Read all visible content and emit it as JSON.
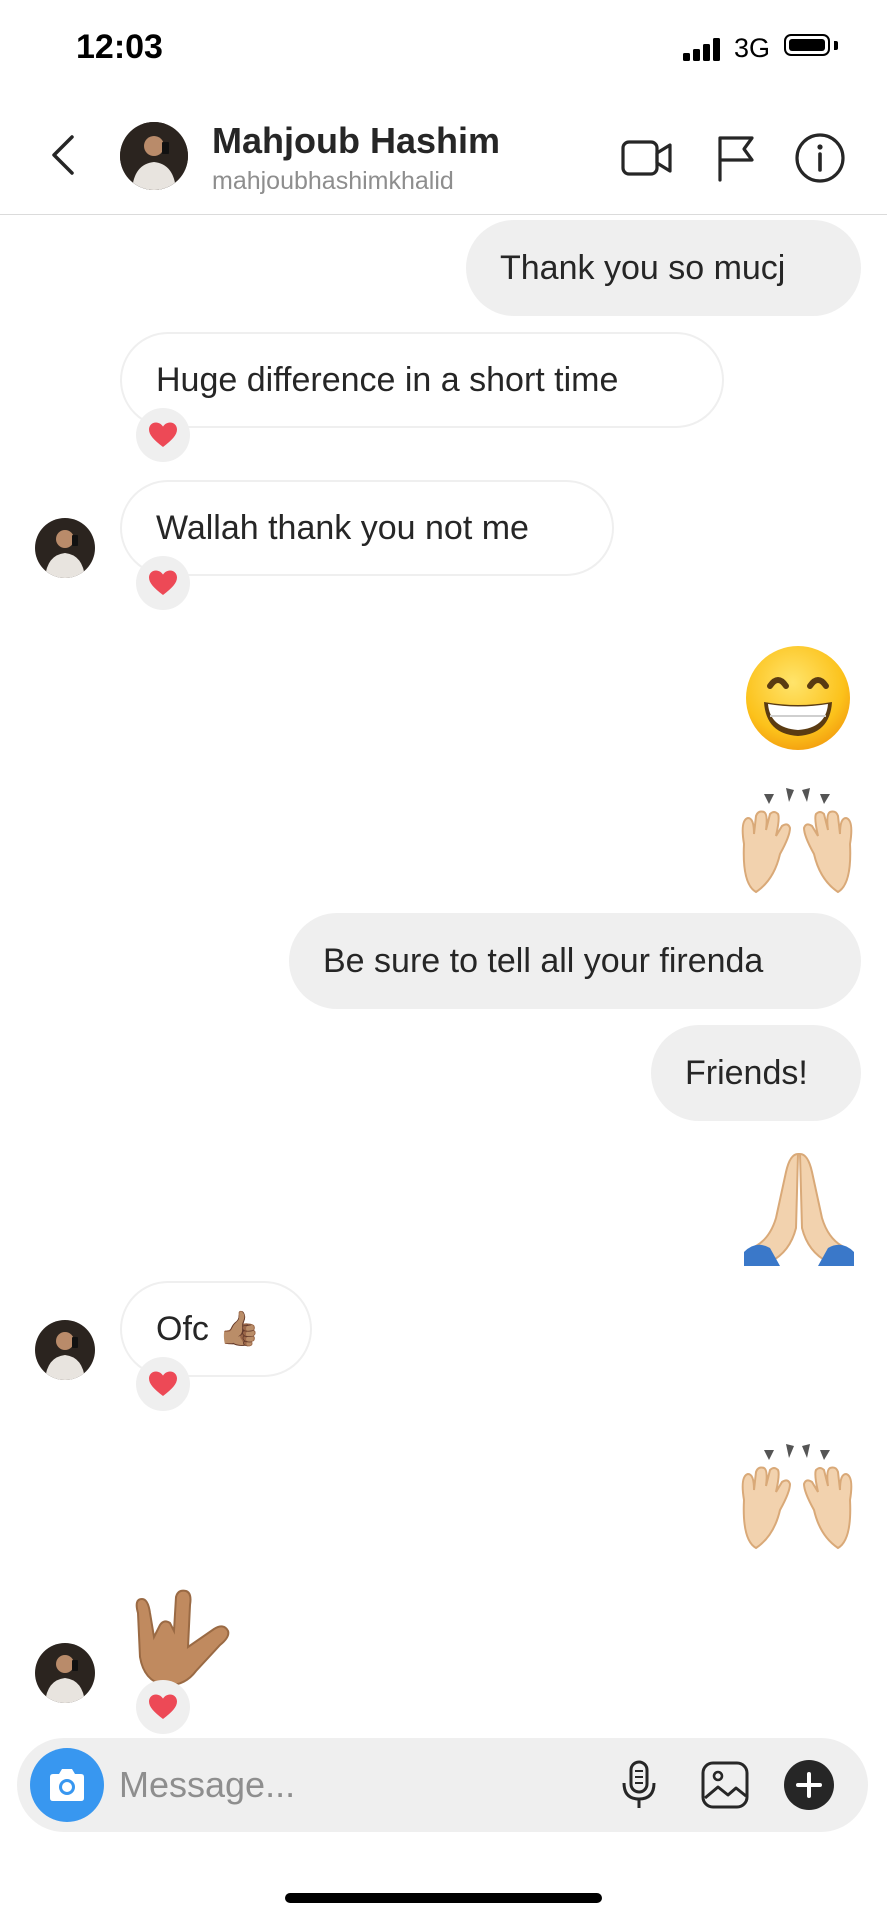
{
  "status_bar": {
    "time": "12:03",
    "network": "3G"
  },
  "header": {
    "name": "Mahjoub Hashim",
    "handle": "mahjoubhashimkhalid",
    "icons": [
      "back-chevron-icon",
      "video-call-icon",
      "flag-icon",
      "info-icon"
    ]
  },
  "messages": [
    {
      "side": "out",
      "text": "Thank you so mucj"
    },
    {
      "side": "in",
      "text": "Huge difference in a short time",
      "reaction": "heart"
    },
    {
      "side": "in",
      "text": "Wallah thank you not me",
      "reaction": "heart"
    },
    {
      "side": "out",
      "emoji": "😁"
    },
    {
      "side": "out",
      "emoji": "🙌"
    },
    {
      "side": "out",
      "text": "Be sure to tell all your firenda"
    },
    {
      "side": "out",
      "text": "Friends!"
    },
    {
      "side": "out",
      "emoji": "🙏"
    },
    {
      "side": "in",
      "text": "Ofc 👍🏽",
      "reaction": "heart"
    },
    {
      "side": "out",
      "emoji": "🙌"
    },
    {
      "side": "in",
      "emoji": "🤟🏽",
      "reaction": "heart"
    }
  ],
  "composer": {
    "placeholder": "Message...",
    "icons": [
      "camera-icon",
      "microphone-icon",
      "gallery-icon",
      "plus-icon"
    ]
  },
  "colors": {
    "accent": "#3897f0",
    "bubble_out": "#efefef",
    "bubble_in_border": "#efefef",
    "heart": "#ed4956",
    "secondary_text": "#8e8e8e"
  }
}
